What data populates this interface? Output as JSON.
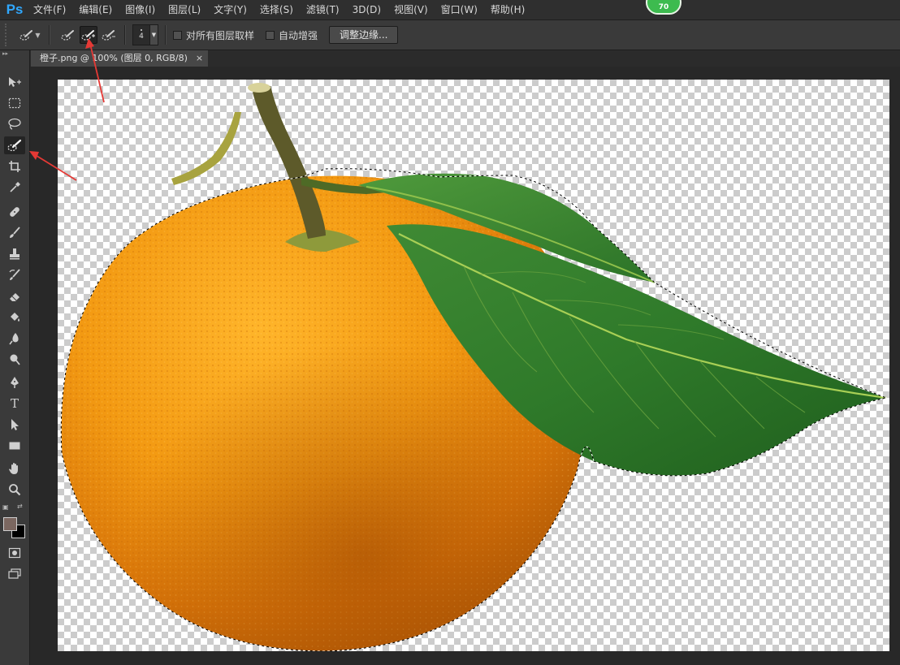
{
  "app": {
    "logo": "Ps"
  },
  "menu": {
    "items": [
      "文件(F)",
      "编辑(E)",
      "图像(I)",
      "图层(L)",
      "文字(Y)",
      "选择(S)",
      "滤镜(T)",
      "3D(D)",
      "视图(V)",
      "窗口(W)",
      "帮助(H)"
    ]
  },
  "badge": {
    "value": "70",
    "color": "#3dbb4f"
  },
  "options": {
    "brush_size": "4",
    "sample_all_layers": "对所有图层取样",
    "auto_enhance": "自动增强",
    "refine_edge": "调整边缘..."
  },
  "document": {
    "tab_title": "橙子.png @ 100% (图层 0, RGB/8)",
    "close_glyph": "×"
  },
  "colors": {
    "foreground": "#7b6760",
    "background": "#000000",
    "accent": "#30a8ff",
    "annotation_arrow": "#e53935"
  },
  "tools": [
    "move-icon",
    "marquee-icon",
    "lasso-icon",
    "quick-selection-icon",
    "crop-icon",
    "eyedropper-icon",
    "healing-brush-icon",
    "brush-icon",
    "clone-stamp-icon",
    "history-brush-icon",
    "eraser-icon",
    "paint-bucket-icon",
    "blur-icon",
    "dodge-icon",
    "pen-icon",
    "type-icon",
    "path-selection-icon",
    "rectangle-icon",
    "hand-icon",
    "zoom-icon"
  ],
  "type_tool_glyph": "T"
}
